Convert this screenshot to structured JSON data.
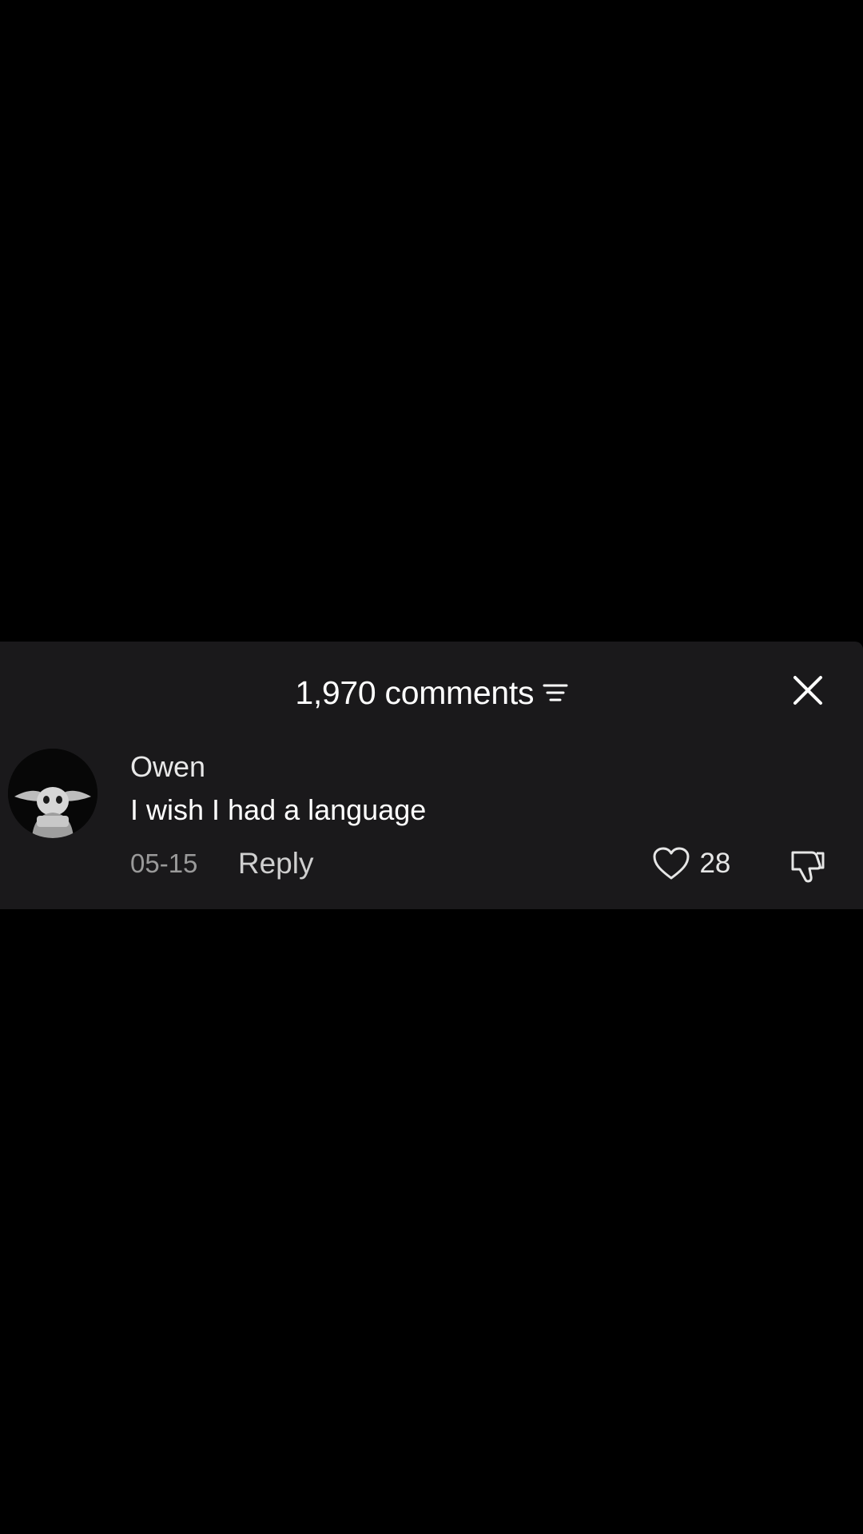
{
  "header": {
    "comments_title": "1,970 comments",
    "filter_icon": "filter-icon",
    "close_icon": "close-icon"
  },
  "comment": {
    "avatar_icon": "avatar",
    "username": "Owen",
    "text": "I wish I had a language",
    "date": "05-15",
    "reply_label": "Reply",
    "like_icon": "heart-icon",
    "like_count": "28",
    "dislike_icon": "dislike-icon"
  },
  "colors": {
    "background": "#000000",
    "panel": "#1a191b",
    "text_primary": "#ffffff",
    "text_secondary": "#9a9a9a"
  }
}
